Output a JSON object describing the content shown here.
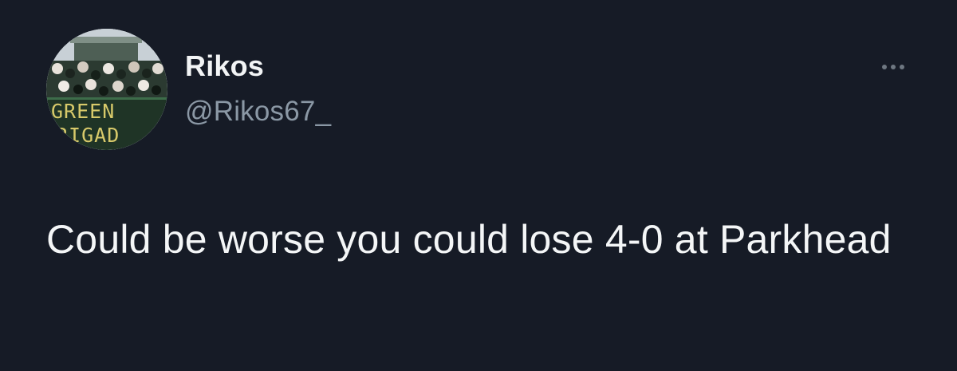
{
  "tweet": {
    "author": {
      "display_name": "Rikos",
      "handle": "@Rikos67_",
      "avatar": {
        "icon": "profile-photo-icon",
        "banner_text_line1": "GREEN",
        "banner_text_line2": "RIGAD"
      }
    },
    "more_icon": "more-horizontal-icon",
    "text": "Could be worse you could lose 4-0 at Parkhead"
  },
  "colors": {
    "background": "#161b26",
    "name_text": "#f2f4f5",
    "handle_text": "#8b98a5",
    "body_text": "#f4f6f7",
    "more_dots": "#6e7781"
  }
}
